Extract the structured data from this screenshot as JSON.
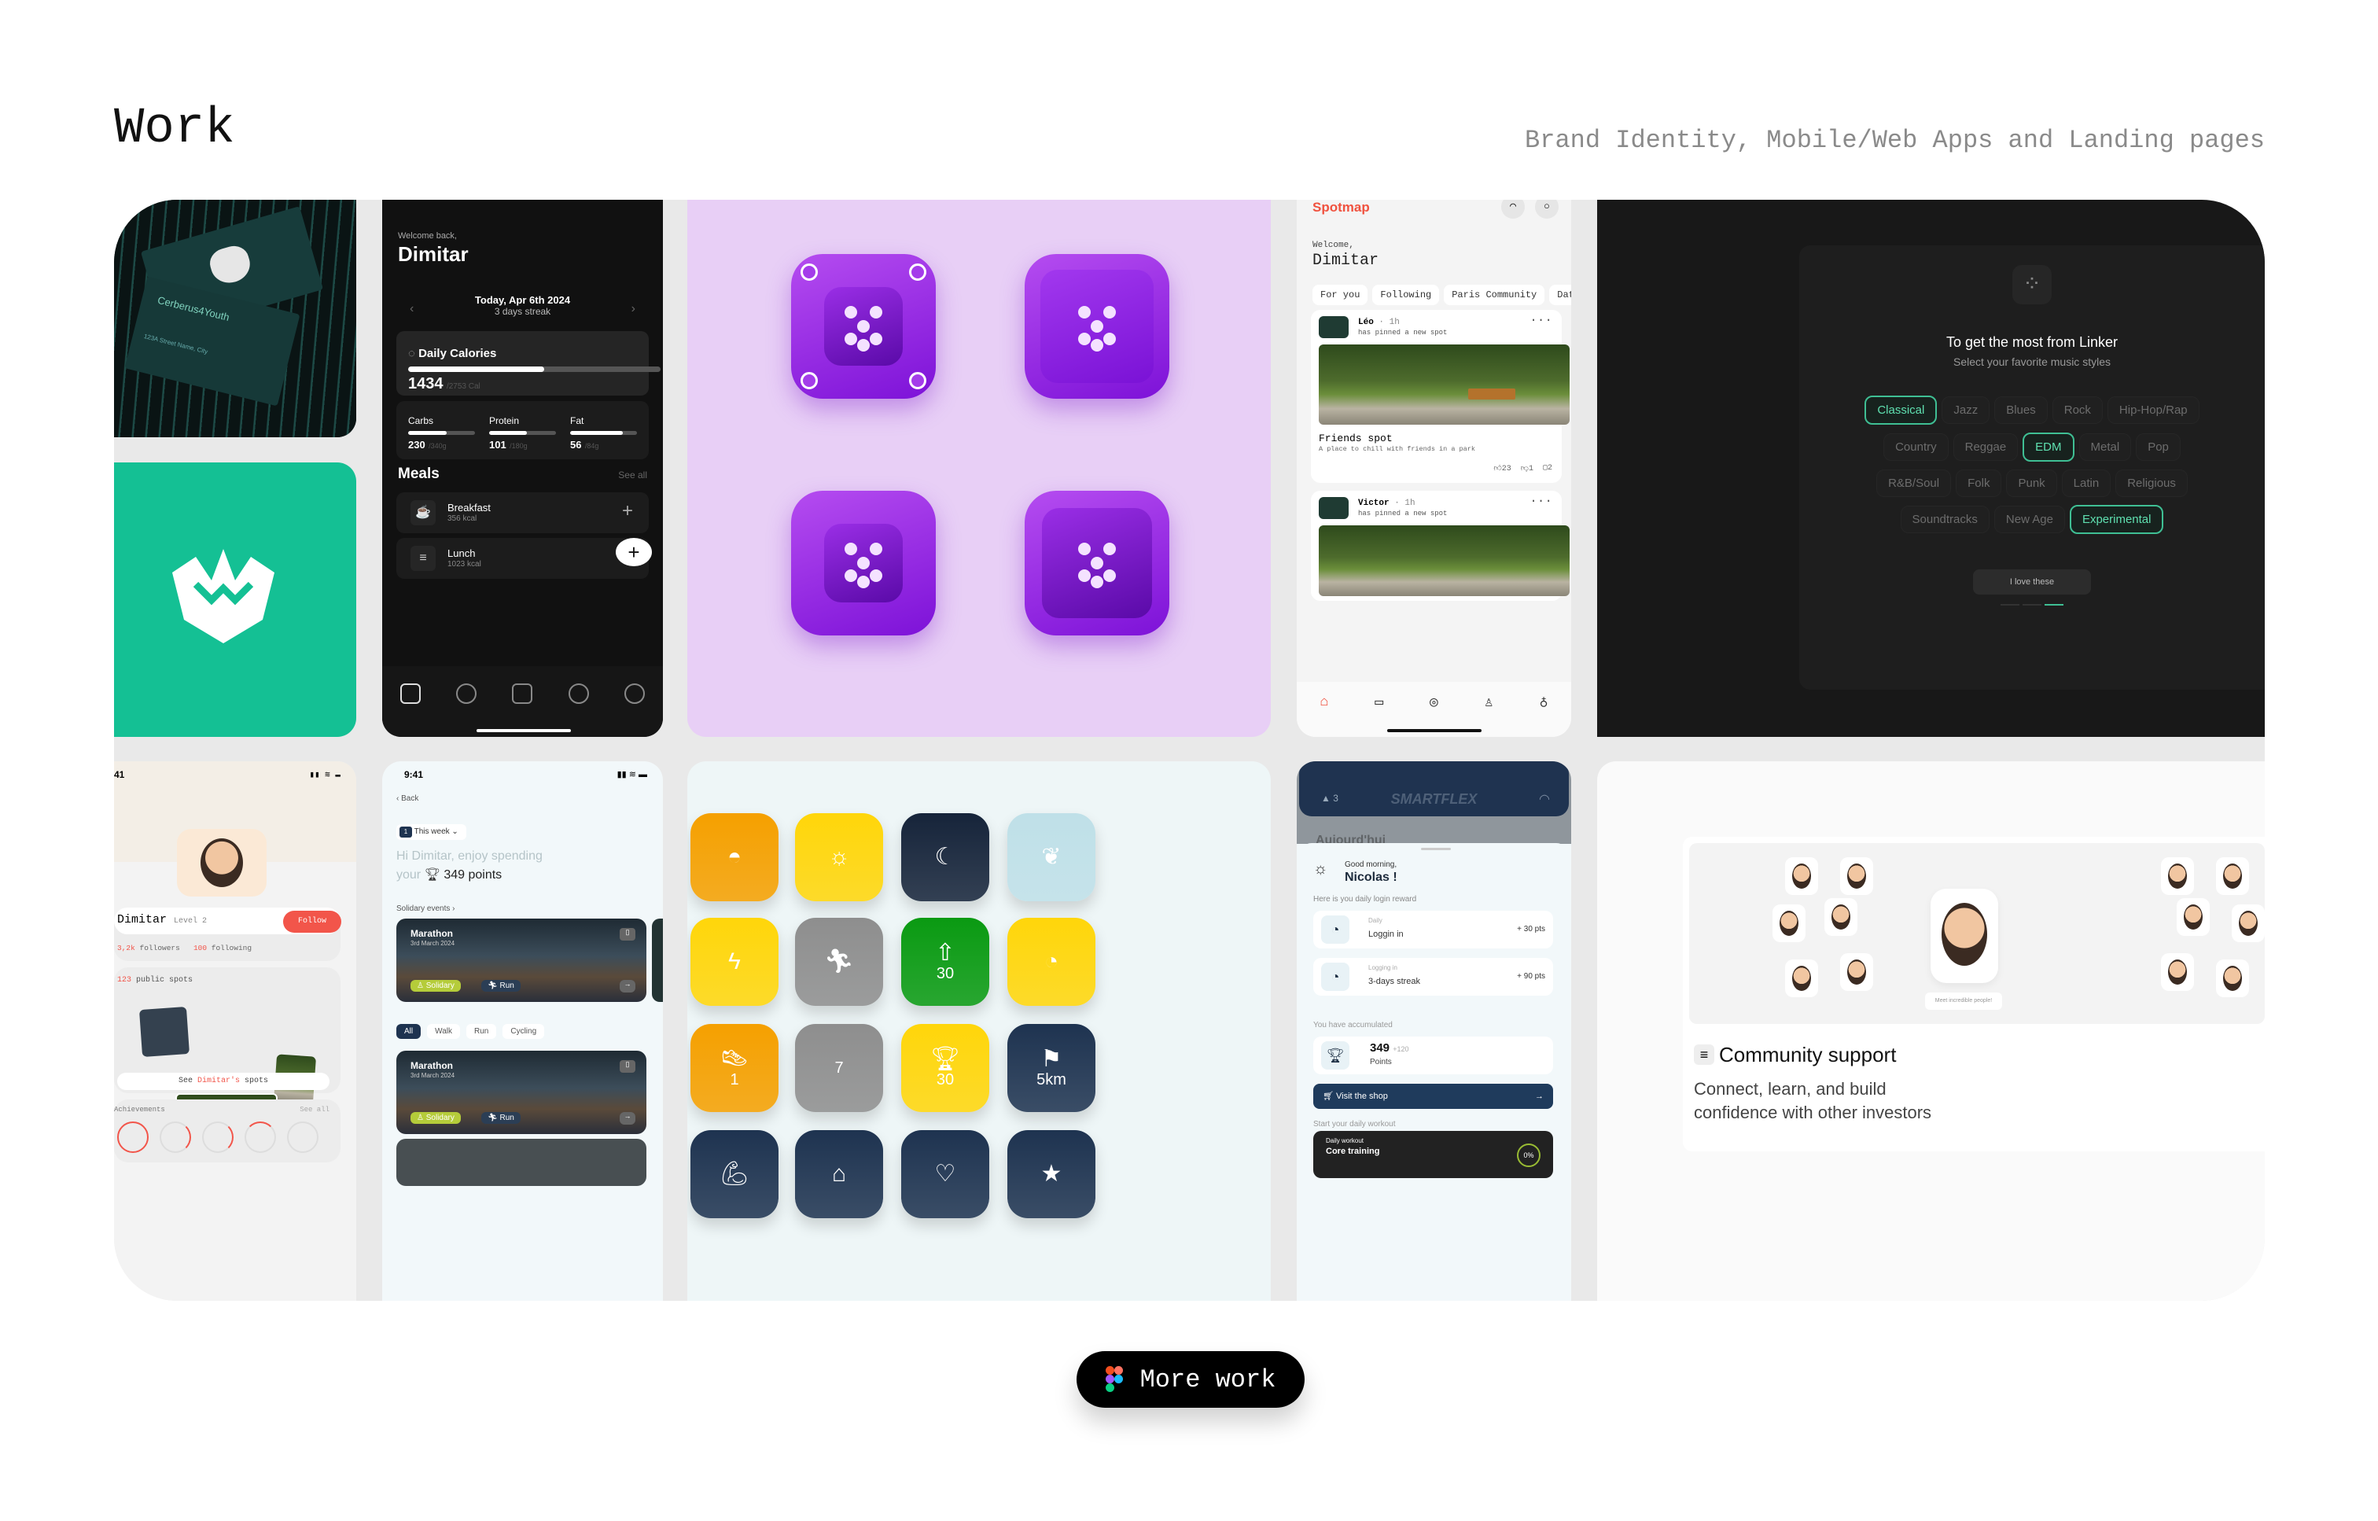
{
  "header": {
    "title": "Work",
    "subtitle": "Brand Identity, Mobile/Web Apps and Landing pages"
  },
  "brand_cards": {
    "company": "Cerberus4Youth",
    "address": "123A Street Name, City"
  },
  "fitness_app": {
    "welcome": "Welcome back,",
    "name": "Dimitar",
    "date": "Today, Apr 6th 2024",
    "streak": "3 days streak",
    "calories": {
      "label": "Daily Calories",
      "value": "1434",
      "goal": "/2753 Cal",
      "progress": 0.54
    },
    "macros": [
      {
        "label": "Carbs",
        "value": "230",
        "goal": "/340g",
        "progress": 0.58
      },
      {
        "label": "Protein",
        "value": "101",
        "goal": "/180g",
        "progress": 0.57
      },
      {
        "label": "Fat",
        "value": "56",
        "goal": "/84g",
        "progress": 0.79
      }
    ],
    "meals_title": "Meals",
    "see_all": "See all",
    "meals": [
      {
        "name": "Breakfast",
        "kcal": "356 kcal"
      },
      {
        "name": "Lunch",
        "kcal": "1023 kcal"
      }
    ],
    "nav": [
      "home-icon",
      "cookie-icon",
      "scan-icon",
      "compass-icon",
      "profile-icon"
    ]
  },
  "spotmap": {
    "logo": "Spotmap",
    "welcome": "Welcome,",
    "name": "Dimitar",
    "tabs": [
      "For you",
      "Following",
      "Paris Community",
      "Dat"
    ],
    "posts": [
      {
        "user": "Léo",
        "time": "· 1h",
        "action": "has pinned a new spot",
        "title": "Friends spot",
        "desc": "A place to chill with friends in a park",
        "likes": "23",
        "dislikes": "1",
        "comments": "2"
      },
      {
        "user": "Victor",
        "time": "· 1h",
        "action": "has pinned a new spot"
      }
    ],
    "accent": "#f0523f"
  },
  "linker": {
    "title": "To get the most from Linker",
    "subtitle": "Select your favorite music styles",
    "genres": [
      [
        "Classical",
        "Jazz",
        "Blues",
        "Rock",
        "Hip-Hop/Rap"
      ],
      [
        "Country",
        "Reggae",
        "EDM",
        "Metal",
        "Pop"
      ],
      [
        "R&B/Soul",
        "Folk",
        "Punk",
        "Latin",
        "Religious"
      ],
      [
        "Soundtracks",
        "New Age",
        "Experimental"
      ]
    ],
    "selected": [
      "Classical",
      "EDM",
      "Experimental"
    ],
    "button": "I love these",
    "accent": "#3fbf94",
    "step": 3,
    "steps": 3
  },
  "profile": {
    "time": "41",
    "name": "Dimitar",
    "level": "Level 2",
    "follow": "Follow",
    "followers_count": "3,2k",
    "followers_label": "followers",
    "following_count": "100",
    "following_label": "following",
    "spots_count": "123",
    "spots_label": "public spots",
    "see_spots": [
      "See ",
      "Dimitar's",
      " spots"
    ],
    "achievements": "Achievements",
    "see_all": "See all"
  },
  "events": {
    "time": "9:41",
    "back": "Back",
    "week_badge": "1",
    "week": "This week",
    "greeting": "Hi Dimitar, enjoy spending",
    "your": "your",
    "points": "349 points",
    "section": "Solidary events",
    "event": {
      "title": "Marathon",
      "date": "3rd March 2024",
      "tag1": "Solidary",
      "tag2": "Run"
    },
    "filters": [
      "All",
      "Walk",
      "Run",
      "Cycling"
    ]
  },
  "badges": [
    {
      "icon": "sunrise-icon",
      "color": "#f5a000",
      "label": ""
    },
    {
      "icon": "sun-icon",
      "color": "#ffd60a",
      "label": ""
    },
    {
      "icon": "moon-icon",
      "color": "#16243a",
      "label": ""
    },
    {
      "icon": "laurel-icon",
      "color": "#bfe0e8",
      "label": ""
    },
    {
      "icon": "bolt-icon",
      "color": "#ffd60a",
      "label": ""
    },
    {
      "icon": "runner-icon",
      "color": "#8e8e8e",
      "label": ""
    },
    {
      "icon": "arrows-up-icon",
      "color": "#0a9a12",
      "label": "30"
    },
    {
      "icon": "stopwatch-icon",
      "color": "#ffd60a",
      "label": ""
    },
    {
      "icon": "shoe-icon",
      "color": "#f5a000",
      "label": "1"
    },
    {
      "icon": "seven-icon",
      "color": "#8e8e8e",
      "label": "7"
    },
    {
      "icon": "trophy-icon",
      "color": "#ffd60a",
      "label": "30"
    },
    {
      "icon": "flag-icon",
      "color": "#1e3350",
      "label": "5km"
    },
    {
      "icon": "muscle-icon",
      "color": "#1e3350",
      "label": ""
    },
    {
      "icon": "abs-icon",
      "color": "#1e3350",
      "label": ""
    },
    {
      "icon": "heart-icon",
      "color": "#1e3350",
      "label": ""
    },
    {
      "icon": "certificate-icon",
      "color": "#1e3350",
      "label": ""
    }
  ],
  "smartflex": {
    "time": "9:41",
    "brand": "SMARTFLEX",
    "streak": "3",
    "behind": "Aujourd'hui",
    "greeting": "Good morning,",
    "name": "Nicolas !",
    "reward_title": "Here is you daily login reward",
    "rewards": [
      {
        "small": "Daily",
        "label": "Loggin in",
        "pts": "+ 30 pts"
      },
      {
        "small": "Logging in",
        "label": "3-days streak",
        "pts": "+ 90 pts"
      }
    ],
    "accum_title": "You have accumulated",
    "points": "349",
    "delta": "+120",
    "points_label": "Points",
    "shop": "Visit the shop",
    "workout_title": "Start your daily workout",
    "workout_small": "Daily workout",
    "workout_name": "Core training",
    "workout_pct": "0%"
  },
  "community": {
    "bubble": "Meet incredible people!",
    "title": "Community support",
    "desc": "Connect, learn, and build confidence with other investors"
  },
  "more_button": "More work"
}
